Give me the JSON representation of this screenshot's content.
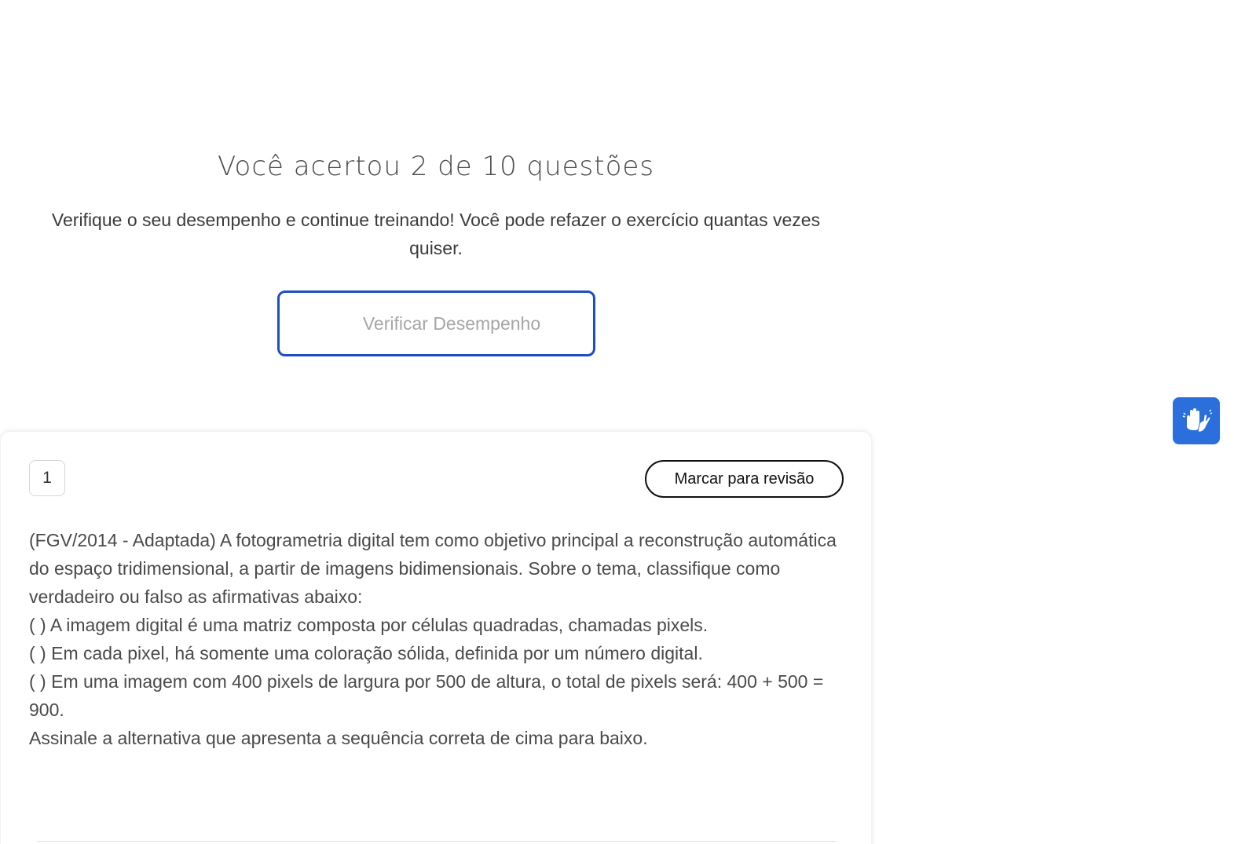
{
  "result": {
    "title": "Você acertou 2 de 10 questões",
    "subtitle": "Verifique o seu desempenho e continue treinando! Você pode refazer o exercício quantas vezes quiser.",
    "verify_button_label": "Verificar Desempenho"
  },
  "question": {
    "number": "1",
    "review_button_label": "Marcar para revisão",
    "lines": [
      "(FGV/2014 - Adaptada) A fotogrametria digital tem como objetivo principal a reconstrução automática do espaço tridimensional, a partir de imagens bidimensionais. Sobre o tema, classifique como verdadeiro ou falso as afirmativas abaixo:",
      "( ) A imagem digital é uma matriz composta por células quadradas, chamadas pixels.",
      "( ) Em cada pixel, há somente uma coloração sólida, definida por um número digital.",
      "( ) Em uma imagem com 400 pixels de largura por 500 de altura, o total de pixels será: 400 + 500 = 900.",
      "Assinale a alternativa que apresenta a sequência correta de cima para baixo."
    ]
  },
  "accessibility_widget": {
    "icon": "sign-language-hands-icon",
    "color": "#2a6fdb"
  },
  "colors": {
    "accent_blue": "#1f4fbf",
    "text": "#4a4a4a"
  }
}
